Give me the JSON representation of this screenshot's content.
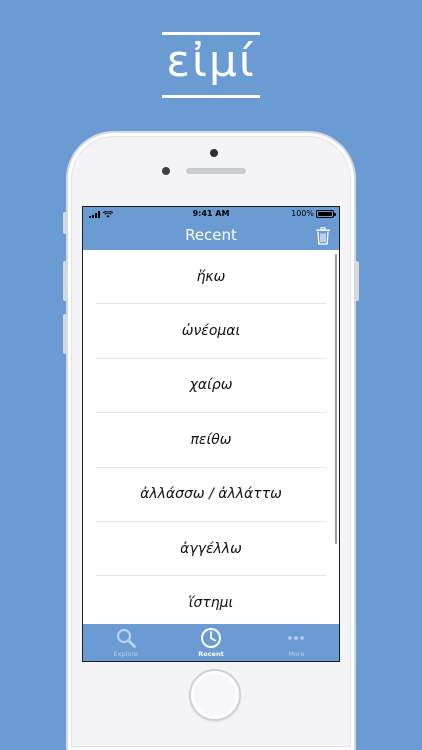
{
  "logo": {
    "text": "εἰμί"
  },
  "status_bar": {
    "time": "9:41 AM",
    "battery": "100%"
  },
  "nav": {
    "title": "Recent"
  },
  "recent_items": [
    "ἥκω",
    "ὠνέομαι",
    "χαίρω",
    "πείθω",
    "ἀλλάσσω / ἀλλάττω",
    "ἀγγέλλω",
    "ἵστημι"
  ],
  "tabs": [
    {
      "label": "Explore",
      "icon": "search-icon",
      "active": false
    },
    {
      "label": "Recent",
      "icon": "clock-icon",
      "active": true
    },
    {
      "label": "More",
      "icon": "more-icon",
      "active": false
    }
  ],
  "colors": {
    "accent": "#6a9bd3",
    "background": "#6a9bd3",
    "tab_inactive": "#b9d1ec"
  }
}
